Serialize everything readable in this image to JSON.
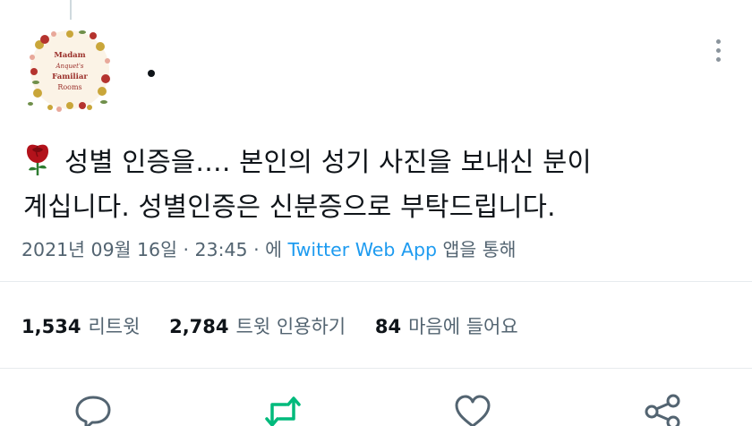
{
  "tweet": {
    "avatar_text": [
      "Madam",
      "Anquet's",
      "Familiar",
      "Rooms"
    ],
    "body_line1": "성별 인증을…. 본인의 성기 사진을 보내신 분이",
    "body_line2": "계십니다. 성별인증은 신분증으로 부탁드립니다.",
    "timestamp": "2021년 09월 16일 · 23:45 · 에 ",
    "source": "Twitter Web App",
    "source_suffix": " 앱을 통해"
  },
  "stats": {
    "retweets": {
      "count": "1,534",
      "label": "리트윗"
    },
    "quotes": {
      "count": "2,784",
      "label": "트윗 인용하기"
    },
    "likes": {
      "count": "84",
      "label": "마음에 들어요"
    }
  },
  "actions": [
    {
      "name": "reply-icon"
    },
    {
      "name": "retweet-icon"
    },
    {
      "name": "like-icon"
    },
    {
      "name": "share-icon"
    }
  ],
  "colors": {
    "text": "#0f1419",
    "secondary": "#536471",
    "link": "#1d9bf0",
    "retweet": "#00ba7c",
    "rose": "#b3121b"
  }
}
